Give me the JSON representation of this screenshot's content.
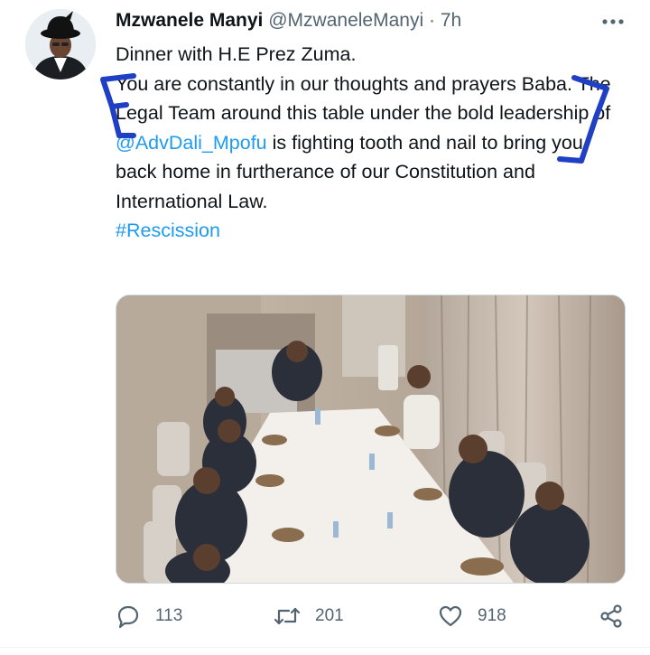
{
  "author": {
    "name": "Mzwanele Manyi",
    "handle": "@MzwaneleManyi",
    "separator": "·",
    "time": "7h"
  },
  "tweet": {
    "line1": "Dinner with H.E Prez Zuma.",
    "part1": "You are constantly in our thoughts and prayers Baba. The Legal Team around this table under the bold leadership of ",
    "mention": "@AdvDali_Mpofu",
    "part2": " is fighting tooth and nail to bring you back home in furtherance of our Constitution and International Law.",
    "hashtag": "#Rescission"
  },
  "actions": {
    "replies": "113",
    "retweets": "201",
    "likes": "918"
  },
  "icons": {
    "more": "more-icon",
    "reply": "reply-icon",
    "retweet": "retweet-icon",
    "like": "heart-icon",
    "share": "share-icon"
  },
  "colors": {
    "link": "#1d9bf0",
    "annotation": "#1f3fc4",
    "secondary": "#536471"
  }
}
